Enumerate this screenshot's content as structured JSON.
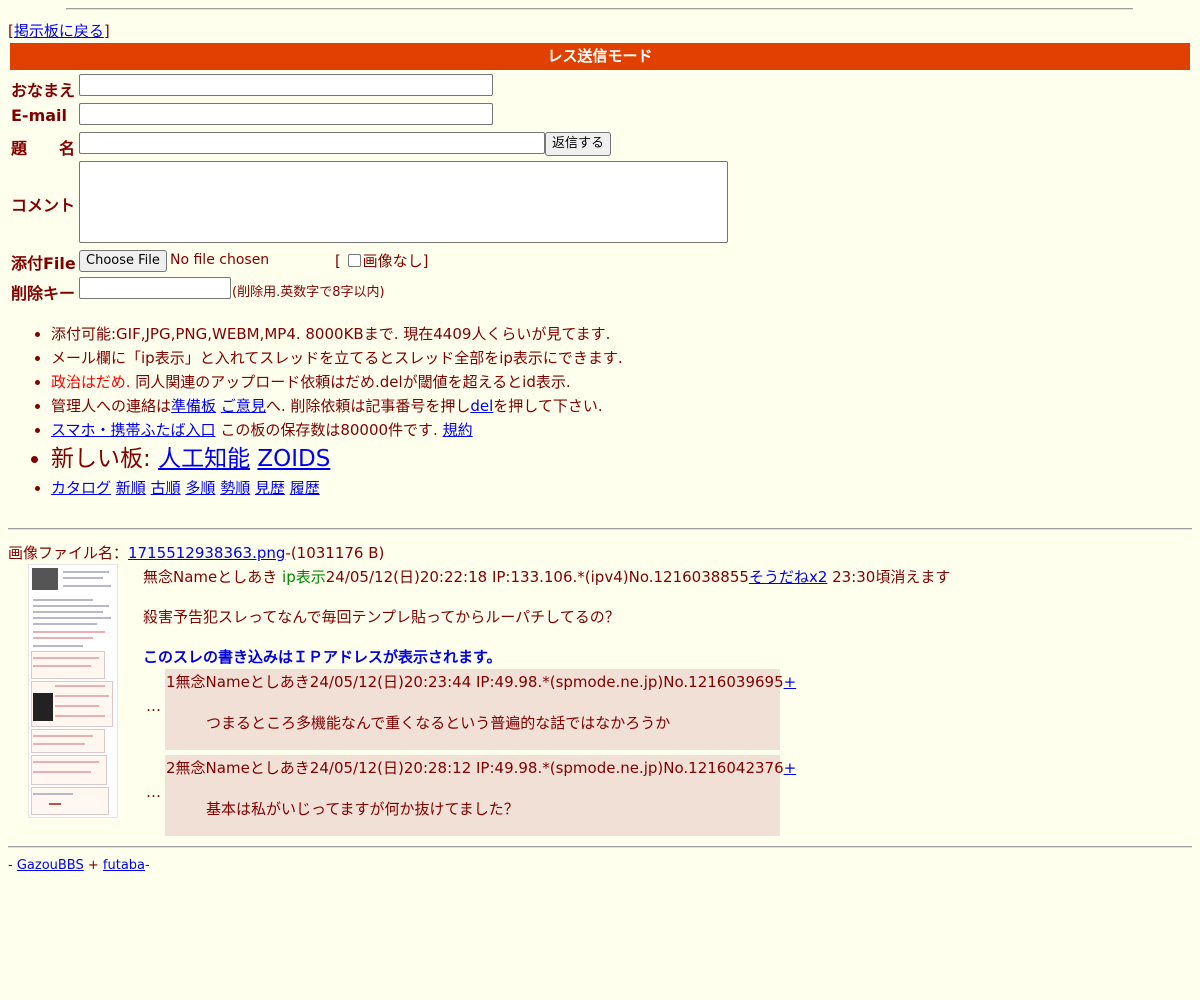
{
  "nav": {
    "back_open": "[",
    "back_link": "掲示板に戻る",
    "back_close": "]"
  },
  "form": {
    "mode_title": "レス送信モード",
    "name_label": "おなまえ",
    "email_label": "E-mail",
    "subject_label": "題　　名",
    "submit_label": "返信する",
    "comment_label": "コメント",
    "file_label": "添付File",
    "file_button": "Choose File",
    "file_status": "No file chosen",
    "noimage_open": "[",
    "noimage_label": "画像なし",
    "noimage_close": "]",
    "delkey_label": "削除キー",
    "delkey_hint": "(削除用.英数字で8字以内)"
  },
  "notes": {
    "line1": "添付可能:GIF,JPG,PNG,WEBM,MP4. 8000KBまで. 現在4409人くらいが見てます.",
    "line2": "メール欄に「ip表示」と入れてスレッドを立てるとスレッド全部をip表示にできます.",
    "line3_red": "政治はだめ.",
    "line3_rest": " 同人関連のアップロード依頼はだめ.delが閾値を超えるとid表示.",
    "line4_a": "管理人への連絡は",
    "line4_link1": "準備板",
    "line4_link2": "ご意見",
    "line4_b": "へ. 削除依頼は記事番号を押し",
    "line4_link3": "del",
    "line4_c": "を押して下さい.",
    "line5_link": "スマホ・携帯ふたば入口",
    "line5_text": " この板の保存数は80000件です. ",
    "line5_link2": "規約",
    "newboards_label": "新しい板: ",
    "newboard1": "人工知能",
    "newboard2": "ZOIDS",
    "sort_links": [
      "カタログ",
      "新順",
      "古順",
      "多順",
      "勢順",
      "見歴",
      "履歴"
    ]
  },
  "thread": {
    "file_label": "画像ファイル名：",
    "file_name": "1715512938363.png",
    "file_size": "-(1031176 B)",
    "op": {
      "name": "無念Nameとしあき",
      "ip_tag": "ip表示",
      "meta": "24/05/12(日)20:22:18 IP:133.106.*(ipv4)No.1216038855",
      "sodane": "そうだねx2",
      "expire": " 23:30頃消えます",
      "body": "殺害予告犯スレってなんで毎回テンプレ貼ってからルーパチしてるの？",
      "ip_notice": "このスレの書き込みはＩＰアドレスが表示されます。"
    },
    "replies": [
      {
        "dots": "…",
        "header": "1無念Nameとしあき24/05/12(日)20:23:44 IP:49.98.*(spmode.ne.jp)No.1216039695",
        "plus": "+",
        "body": "つまるところ多機能なんで重くなるという普遍的な話ではなかろうか"
      },
      {
        "dots": "…",
        "header": "2無念Nameとしあき24/05/12(日)20:28:12 IP:49.98.*(spmode.ne.jp)No.1216042376",
        "plus": "+",
        "body": "基本は私がいじってますが何か抜けてました？"
      }
    ]
  },
  "footer": {
    "prefix": "- ",
    "link1": "GazouBBS",
    "sep": " + ",
    "link2": "futaba",
    "suffix": "-"
  },
  "colors": {
    "background": "#ffffee",
    "text": "#800000",
    "mode_bar": "#e04000",
    "reply_bg": "#f0e0d6",
    "ip_notice": "#0000dd",
    "ip_tag": "#008800"
  }
}
